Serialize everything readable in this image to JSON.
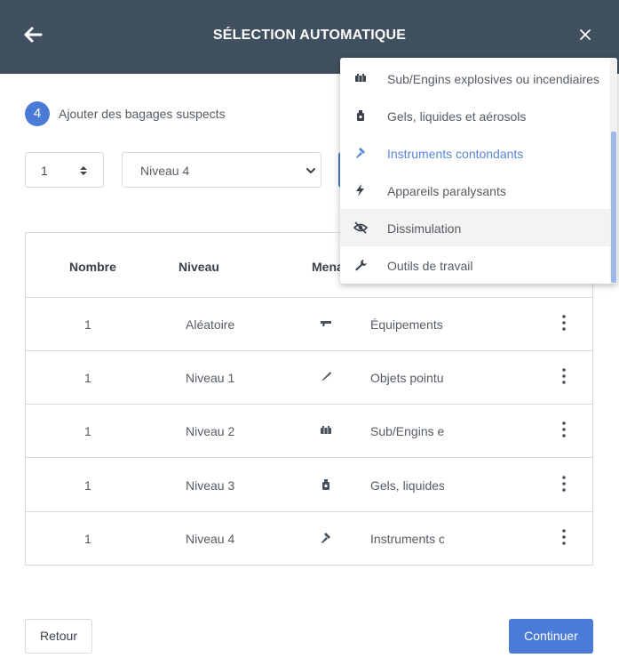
{
  "header": {
    "title": "SÉLECTION AUTOMATIQUE",
    "back_icon": "arrow-left-icon",
    "close_icon": "close-icon"
  },
  "step": {
    "number": "4",
    "label": "Ajouter des bagages suspects"
  },
  "form": {
    "quantity_value": "1",
    "level_value": "Niveau 4"
  },
  "table": {
    "headers": [
      "Nombre",
      "Niveau",
      "Mena"
    ],
    "rows": [
      {
        "nombre": "1",
        "niveau": "Aléatoire",
        "icon": "gun-icon",
        "categorie": "Équipements"
      },
      {
        "nombre": "1",
        "niveau": "Niveau 1",
        "icon": "knife-icon",
        "categorie": "Objets pointus"
      },
      {
        "nombre": "1",
        "niveau": "Niveau 2",
        "icon": "explosive-icon",
        "categorie": "Sub/Engins explosives"
      },
      {
        "nombre": "1",
        "niveau": "Niveau 3",
        "icon": "bottle-icon",
        "categorie": "Gels, liquides"
      },
      {
        "nombre": "1",
        "niveau": "Niveau 4",
        "icon": "hammer-icon",
        "categorie": "Instruments contondants"
      }
    ]
  },
  "dropdown": {
    "items": [
      {
        "label": "Sub/Engins explosives ou incendiaires",
        "icon": "explosive-icon"
      },
      {
        "label": "Gels, liquides et aérosols",
        "icon": "bottle-icon"
      },
      {
        "label": "Instruments contondants",
        "icon": "hammer-icon",
        "state": "selected"
      },
      {
        "label": "Appareils paralysants",
        "icon": "lightning-icon"
      },
      {
        "label": "Dissimulation",
        "icon": "eye-slash-icon",
        "state": "hover"
      },
      {
        "label": "Outils de travail",
        "icon": "wrench-icon"
      }
    ]
  },
  "footer": {
    "back_label": "Retour",
    "next_label": "Continuer"
  },
  "colors": {
    "header_bg": "#415060",
    "accent": "#4a7bd6",
    "selected_text": "#5b86d9",
    "border": "#d7dbe0"
  }
}
